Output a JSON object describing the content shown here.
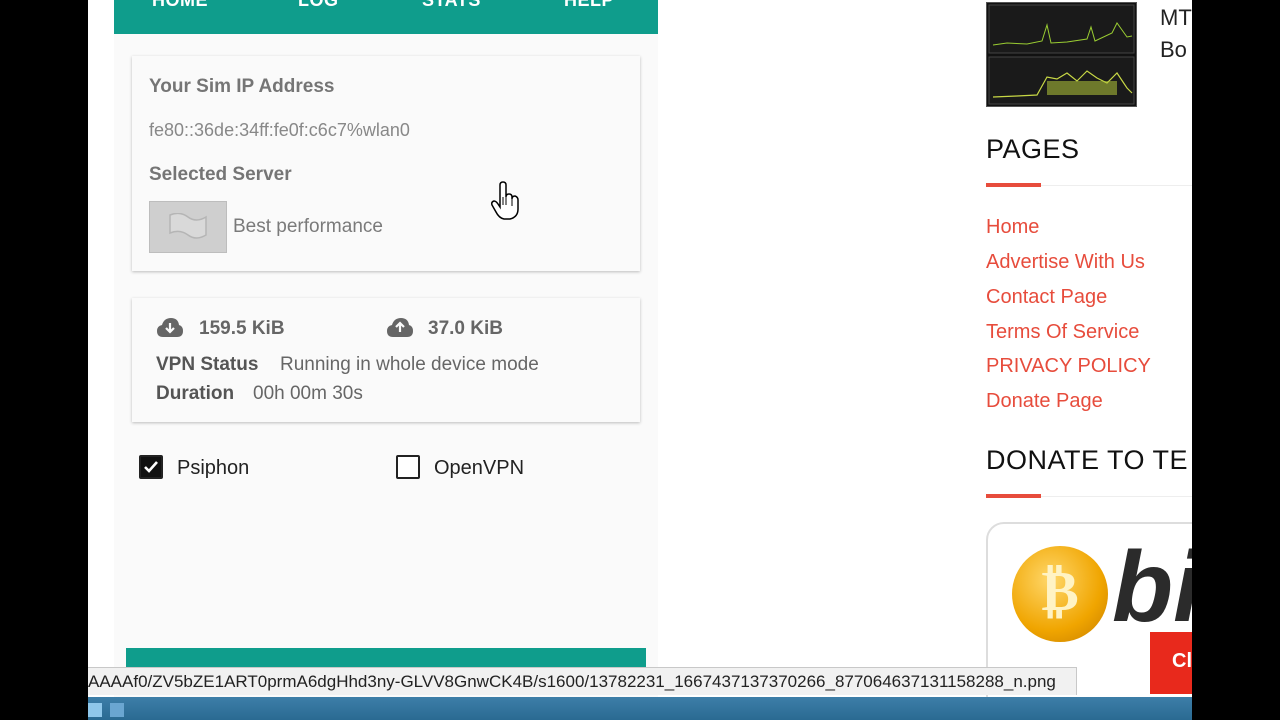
{
  "app": {
    "tabs": [
      "HOME",
      "LOG",
      "STATS",
      "HELP"
    ],
    "ip_label": "Your Sim IP Address",
    "ip_value": "fe80::36de:34ff:fe0f:c6c7%wlan0",
    "server_label": "Selected Server",
    "server_value": "Best performance",
    "download": "159.5 KiB",
    "upload": "37.0 KiB",
    "vpn_status_label": "VPN Status",
    "vpn_status_value": "Running in whole device mode",
    "duration_label": "Duration",
    "duration_value": "00h 00m 30s",
    "options": [
      {
        "label": "Psiphon",
        "checked": true
      },
      {
        "label": "OpenVPN",
        "checked": false
      }
    ]
  },
  "sidebar": {
    "post_title_line1": "MT",
    "post_title_line2": "Bo",
    "pages_title": "PAGES",
    "pages": [
      "Home",
      "Advertise With Us",
      "Contact Page",
      "Terms Of Service",
      "PRIVACY POLICY",
      "Donate Page"
    ],
    "donate_title": "DONATE TO TE",
    "donate_image_text": "bi",
    "donate_tag": "Cl",
    "accent_color": "#e74c3c"
  },
  "statusbar": {
    "url": "AAAAf0/ZV5bZE1ART0prmA6dgHhd3ny-GLVV8GnwCK4B/s1600/13782231_1667437137370266_877064637131158288_n.png"
  },
  "colors": {
    "teal": "#0f9d8c"
  }
}
